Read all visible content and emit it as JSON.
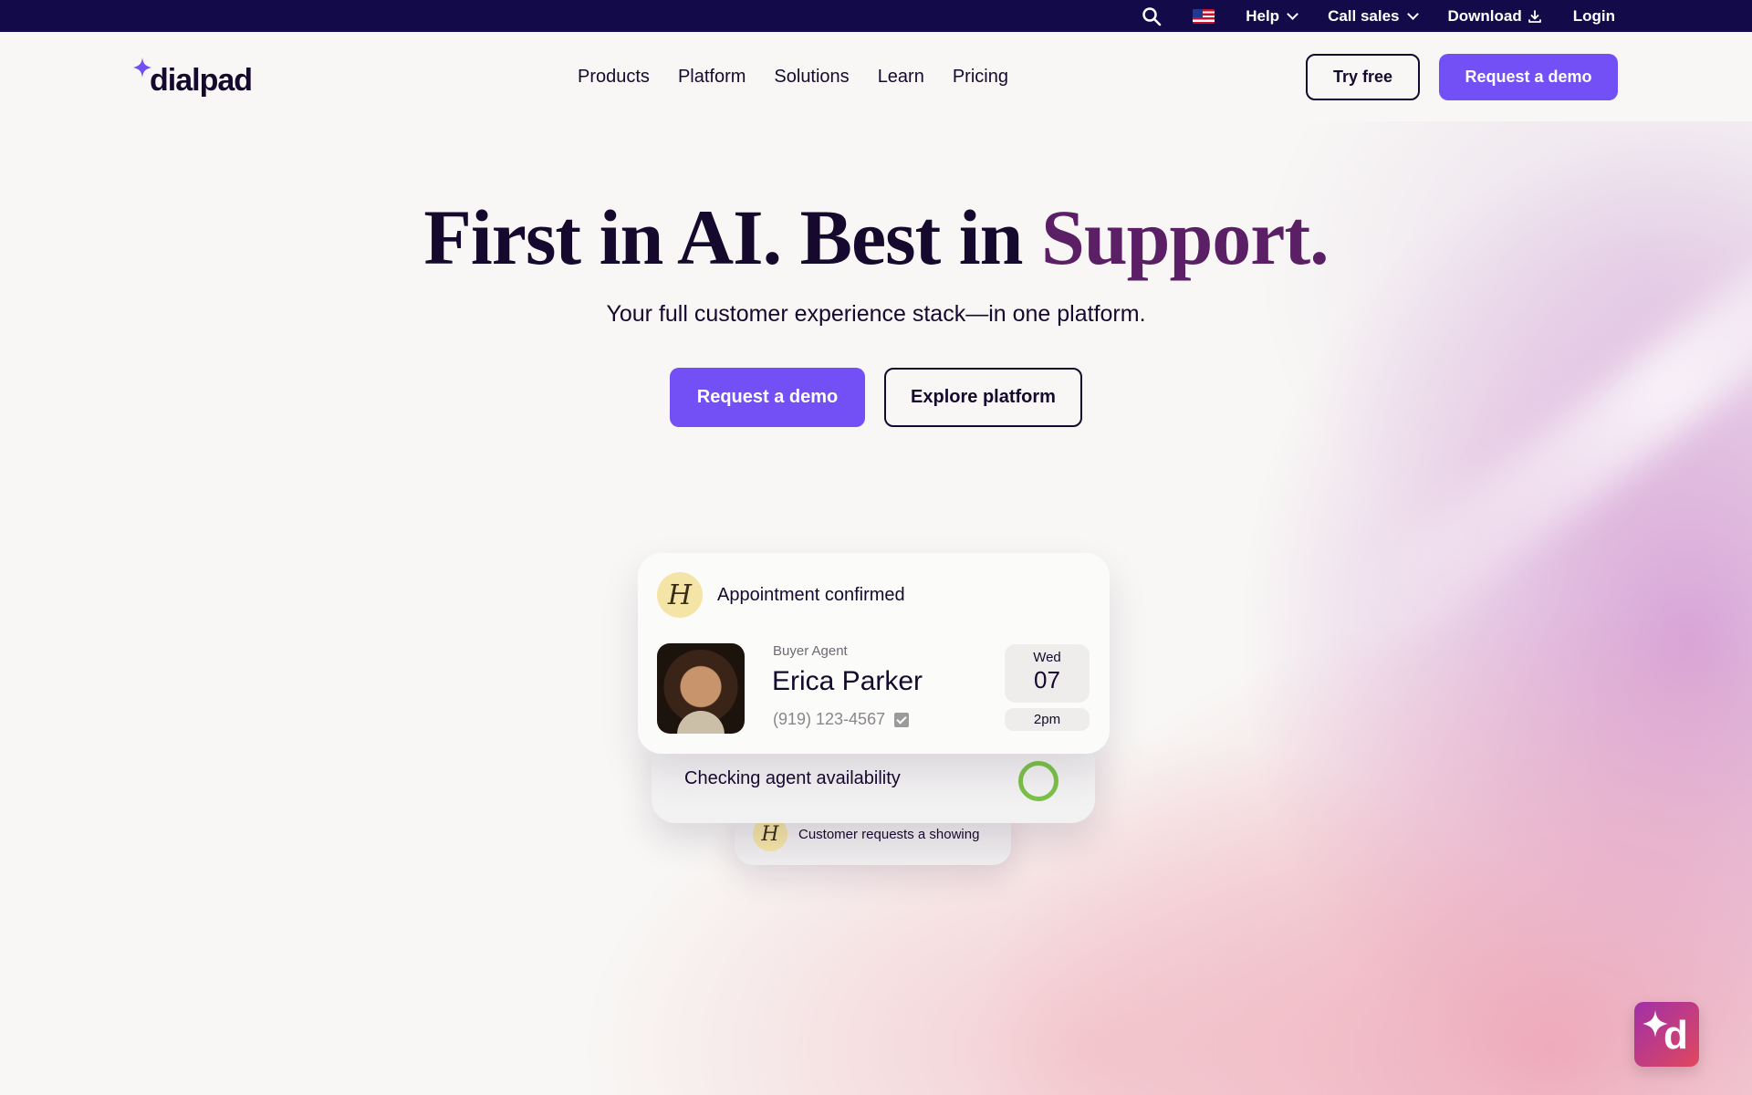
{
  "topbar": {
    "help_label": "Help",
    "call_sales_label": "Call sales",
    "download_label": "Download",
    "login_label": "Login"
  },
  "nav": {
    "logo_text": "dialpad",
    "links": [
      "Products",
      "Platform",
      "Solutions",
      "Learn",
      "Pricing"
    ],
    "try_free_label": "Try free",
    "request_demo_label": "Request a demo"
  },
  "hero": {
    "title_part1": "First in AI. Best in ",
    "title_accent": "Support.",
    "subtitle": "Your full customer experience stack—in one platform.",
    "primary_cta": "Request a demo",
    "secondary_cta": "Explore platform"
  },
  "cards": {
    "front": {
      "badge_letter": "H",
      "title": "Appointment confirmed",
      "role": "Buyer Agent",
      "name": "Erica Parker",
      "phone": "(919) 123-4567",
      "day": "Wed",
      "date": "07",
      "time": "2pm"
    },
    "middle": {
      "text": "Checking agent availability"
    },
    "back": {
      "badge_letter": "H",
      "text": "Customer requests a showing"
    }
  },
  "chat_widget": {
    "letter": "d"
  },
  "colors": {
    "topbar_bg": "#130a4a",
    "primary": "#7350f5",
    "accent_text": "#5b1f66",
    "ring": "#7bc24a"
  }
}
